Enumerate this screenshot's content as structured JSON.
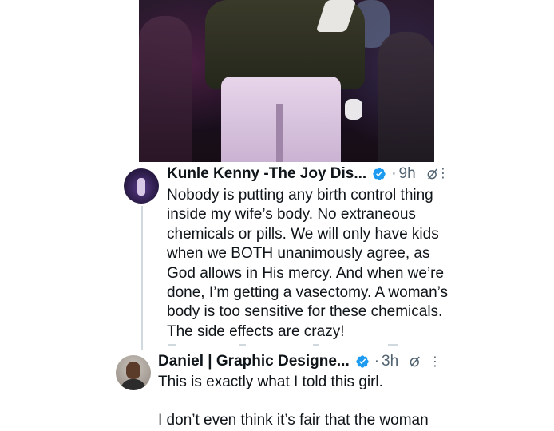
{
  "tweets": [
    {
      "name": "Kunle Kenny -The Joy Dis...",
      "time": "9h",
      "text": "Nobody is putting any birth control thing inside my wife’s body. No extraneous chemicals or pills. We will only have kids when we BOTH unanimously agree, as God allows in His mercy. And when we’re done, I’m getting a vasectomy. A woman’s body is too sensitive for these chemicals. The side effects are crazy!"
    },
    {
      "name": "Daniel | Graphic Designe...",
      "time": "3h",
      "line1": "This is exactly what I told this girl.",
      "line2": "I don’t even think it’s fair that the woman"
    }
  ],
  "separator": "·",
  "more_glyph": "⋮",
  "colors": {
    "verified": "#1d9bf0",
    "muted": "#536471",
    "text": "#0f1419"
  },
  "icons": [
    "verified-badge-icon",
    "grok-icon",
    "more-icon"
  ]
}
